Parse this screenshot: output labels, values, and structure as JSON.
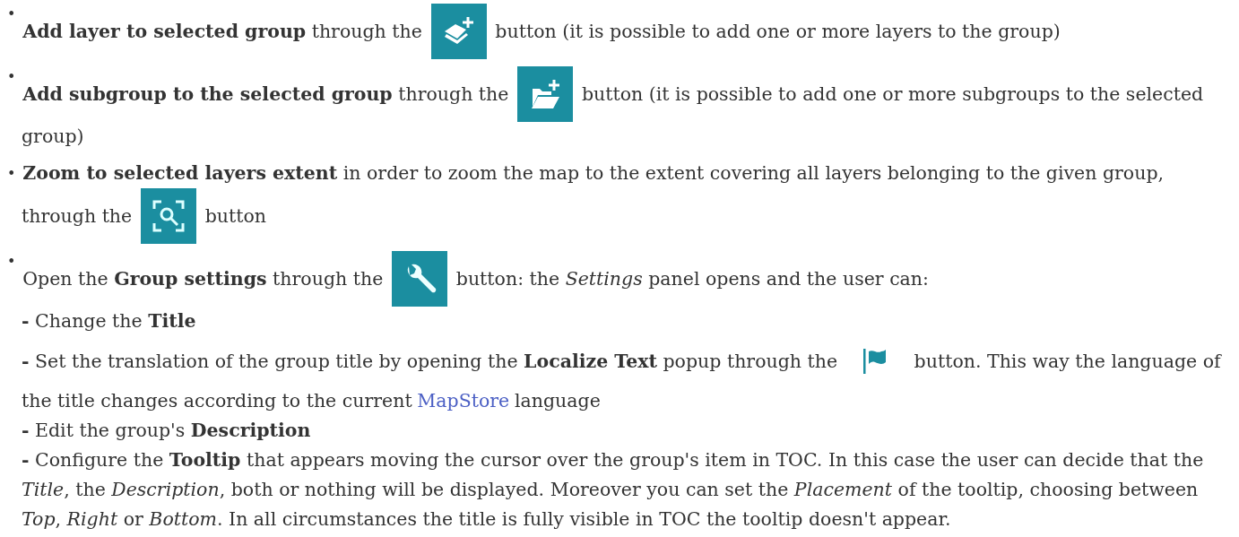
{
  "items": [
    {
      "marker": "•",
      "lines": [
        [
          {
            "kind": "text",
            "text": "**Add layer to selected group** through the"
          },
          {
            "kind": "icon"
          },
          {
            "kind": "text",
            "text": "button (it is possible to add one or more layers to the group)"
          }
        ]
      ]
    },
    {
      "marker": "•",
      "lines": [
        [
          {
            "kind": "text",
            "text": "**Add subgroup to the selected group** through the"
          },
          {
            "kind": "icon"
          },
          {
            "kind": "text",
            "text": "button (it is possible to add one or more subgroups to the selected"
          }
        ],
        [
          {
            "kind": "text",
            "text": "group)"
          }
        ]
      ]
    },
    {
      "marker": "•",
      "lines": [
        [
          {
            "kind": "text",
            "text": "**Zoom to selected layers extent** in order to zoom the map to the extent covering all layers belonging to the given group,"
          }
        ],
        [
          {
            "kind": "text",
            "text": "through the"
          },
          {
            "kind": "icon"
          },
          {
            "kind": "text",
            "text": "button"
          }
        ]
      ]
    },
    {
      "marker": "•",
      "lines": [
        [
          {
            "kind": "text",
            "text": "Open the **Group settings** through the"
          },
          {
            "kind": "icon"
          },
          {
            "kind": "text",
            "text": "button: the *Settings* panel opens and the user can:"
          }
        ]
      ],
      "sublines": [
        [
          [
            {
              "kind": "text",
              "text": "**-** Change the **Title**"
            }
          ]
        ],
        [
          [
            {
              "kind": "text",
              "text": "**-** Set the translation of the group title by opening the **Localize Text** popup through the"
            },
            {
              "kind": "icon"
            },
            {
              "kind": "text",
              "text": "button. This way the language of"
            }
          ],
          [
            {
              "kind": "text",
              "text": "the title changes according to the current"
            },
            {
              "kind": "link",
              "text": "MapStore"
            },
            {
              "kind": "text",
              "text": "language"
            }
          ]
        ],
        [
          [
            {
              "kind": "text",
              "text": "**-** Edit the group's **Description**"
            }
          ]
        ],
        [
          [
            {
              "kind": "text",
              "text": "**-** Configure the **Tooltip** that appears moving the cursor over the group's item in TOC. In this case the user can decide that the"
            }
          ],
          [
            {
              "kind": "text",
              "text": "*Title*, the *Description*, both or nothing will be displayed. Moreover you can set the *Placement* of the tooltip, choosing between"
            }
          ],
          [
            {
              "kind": "text",
              "text": "*Top*, *Right* or *Bottom*. In all circumstances the title is fully visible in TOC the tooltip doesn't appear."
            }
          ]
        ]
      ]
    }
  ]
}
